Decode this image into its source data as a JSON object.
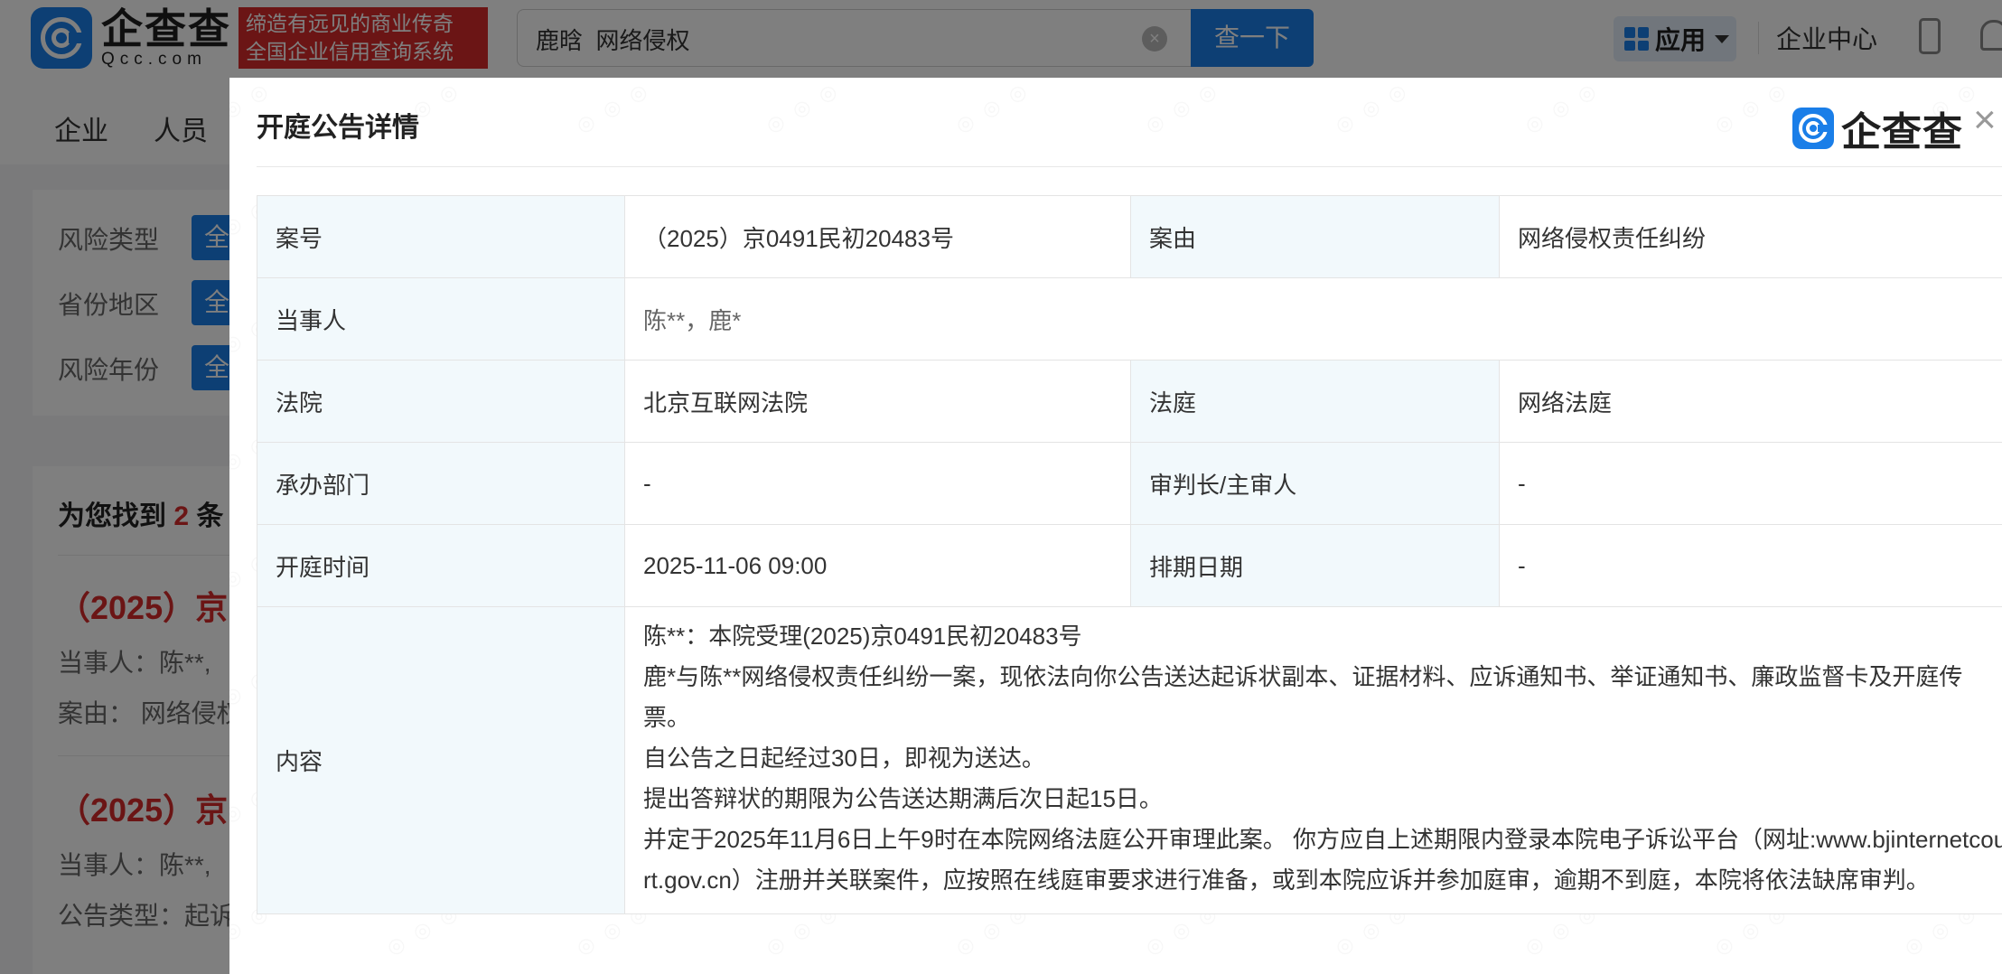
{
  "header": {
    "logo_cn": "企查查",
    "logo_en": "Qcc.com",
    "slogan_line1": "缔造有远见的商业传奇",
    "slogan_line2": "全国企业信用查询系统",
    "search_value": "鹿晗  网络侵权",
    "search_button": "查一下",
    "app_label": "应用",
    "enterprise_center": "企业中心"
  },
  "nav": {
    "items": [
      "企业",
      "人员"
    ]
  },
  "filters": {
    "rows": [
      {
        "label": "风险类型",
        "tag": "全"
      },
      {
        "label": "省份地区",
        "tag": "全"
      },
      {
        "label": "风险年份",
        "tag": "全"
      }
    ]
  },
  "results": {
    "prefix": "为您找到",
    "count": "2",
    "suffix": "条",
    "items": [
      {
        "title": "（2025）京",
        "line1": "当事人：陈**,",
        "line2": "案由：   网络侵权"
      },
      {
        "title": "（2025）京",
        "line1": "当事人：陈**,",
        "line2": "公告类型：起诉"
      }
    ]
  },
  "modal": {
    "title": "开庭公告详情",
    "logo_text": "企查查",
    "close": "×",
    "rows": {
      "case_no_label": "案号",
      "case_no": "（2025）京0491民初20483号",
      "cause_label": "案由",
      "cause": "网络侵权责任纠纷",
      "parties_label": "当事人",
      "parties": "陈**，鹿*",
      "court_label": "法院",
      "court": "北京互联网法院",
      "tribunal_label": "法庭",
      "tribunal": "网络法庭",
      "dept_label": "承办部门",
      "dept": "-",
      "judge_label": "审判长/主审人",
      "judge": "-",
      "hearing_time_label": "开庭时间",
      "hearing_time": "2025-11-06 09:00",
      "schedule_label": "排期日期",
      "schedule": "-",
      "content_label": "内容",
      "content_lines": [
        "陈**：本院受理(2025)京0491民初20483号",
        "鹿*与陈**网络侵权责任纠纷一案，现依法向你公告送达起诉状副本、证据材料、应诉通知书、举证通知书、廉政监督卡及开庭传票。",
        "自公告之日起经过30日，即视为送达。",
        "提出答辩状的期限为公告送达期满后次日起15日。",
        "并定于2025年11月6日上午9时在本院网络法庭公开审理此案。 你方应自上述期限内登录本院电子诉讼平台（网址:www.bjinternetcourt.gov.cn）注册并关联案件，应按照在线庭审要求进行准备，或到本院应诉并参加庭审，逾期不到庭，本院将依法缺席审判。"
      ]
    }
  }
}
